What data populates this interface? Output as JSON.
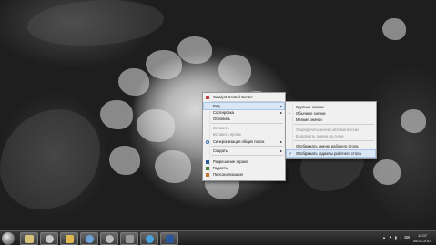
{
  "context_menu": {
    "items": [
      {
        "label": "Catalyst Control Center",
        "state": "enabled",
        "icon": "ati-icon",
        "submenu": false
      },
      {
        "label": "Вид",
        "state": "highlighted",
        "icon": "",
        "submenu": true
      },
      {
        "label": "Сортировка",
        "state": "enabled",
        "icon": "",
        "submenu": true
      },
      {
        "label": "Обновить",
        "state": "enabled",
        "icon": "",
        "submenu": false
      },
      {
        "label": "Вставить",
        "state": "disabled",
        "icon": "",
        "submenu": false
      },
      {
        "label": "Вставить ярлык",
        "state": "disabled",
        "icon": "",
        "submenu": false
      },
      {
        "label": "Синхронизация общих папок",
        "state": "enabled",
        "icon": "sync-icon",
        "submenu": true
      },
      {
        "label": "Создать",
        "state": "enabled",
        "icon": "",
        "submenu": true
      },
      {
        "label": "Разрешение экрана",
        "state": "enabled",
        "icon": "display-icon",
        "submenu": false
      },
      {
        "label": "Гаджеты",
        "state": "enabled",
        "icon": "gadget-icon",
        "submenu": false
      },
      {
        "label": "Персонализация",
        "state": "enabled",
        "icon": "personalize-icon",
        "submenu": false
      }
    ]
  },
  "view_submenu": {
    "items": [
      {
        "label": "Крупные значки",
        "mark": "",
        "state": "enabled"
      },
      {
        "label": "Обычные значки",
        "mark": "•",
        "state": "enabled"
      },
      {
        "label": "Мелкие значки",
        "mark": "",
        "state": "enabled"
      },
      {
        "label": "Упорядочить значки автоматически",
        "mark": "",
        "state": "disabled"
      },
      {
        "label": "Выровнять значки по сетке",
        "mark": "",
        "state": "disabled"
      },
      {
        "label": "Отображать значки рабочего стола",
        "mark": "",
        "state": "enabled"
      },
      {
        "label": "Отображать гаджеты  рабочего стола",
        "mark": "✓",
        "state": "highlighted"
      }
    ]
  },
  "taskbar": {
    "apps": [
      "explorer-icon",
      "wmp-icon",
      "ie-icon",
      "chrome-icon",
      "skype-icon",
      "word-icon",
      "word-icon"
    ],
    "tray_icons": "▲ ⚑ ▮ ♪ ⌨",
    "clock_time": "12:07",
    "clock_date": "08.01.2014"
  }
}
